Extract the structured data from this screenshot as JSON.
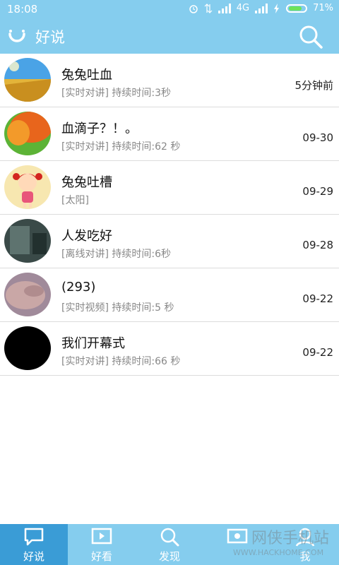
{
  "status_bar": {
    "time": "18:08",
    "network": "4G",
    "battery": "71%"
  },
  "app_bar": {
    "title": "好说"
  },
  "conversations": [
    {
      "name": "兔兔吐血",
      "subtitle": "[实时对讲] 持续时间:3秒",
      "time": "5分钟前"
    },
    {
      "name": "血滴子？！。",
      "subtitle": "[实时对讲] 持续时间:62 秒",
      "time": "09-30"
    },
    {
      "name": "兔兔吐槽",
      "subtitle": "[太阳]",
      "time": "09-29"
    },
    {
      "name": "人发吃好",
      "subtitle": "[离线对讲] 持续时间:6秒",
      "time": "09-28"
    },
    {
      "name": "(293)",
      "subtitle": "[实时视频] 持续时间:5 秒",
      "time": "09-22"
    },
    {
      "name": "我们开幕式",
      "subtitle": "[实时对讲] 持续时间:66 秒",
      "time": "09-22"
    }
  ],
  "bottom_nav": [
    {
      "label": "好说",
      "icon": "chat-icon",
      "active": true
    },
    {
      "label": "好看",
      "icon": "play-icon",
      "active": false
    },
    {
      "label": "发现",
      "icon": "search-icon",
      "active": false
    },
    {
      "label": "",
      "icon": "message-icon",
      "active": false
    },
    {
      "label": "我",
      "icon": "profile-icon",
      "active": false
    }
  ],
  "watermark": {
    "line1": "网侠手机站",
    "line2": "WWW.HACKHOME.COM"
  },
  "colors": {
    "primary": "#85cdee",
    "active_tab": "#3a9cd6"
  }
}
